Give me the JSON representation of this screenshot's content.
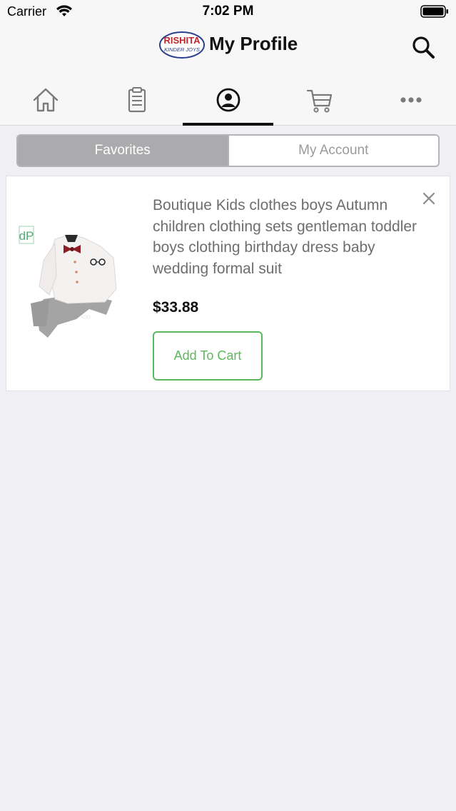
{
  "status_bar": {
    "carrier": "Carrier",
    "time": "7:02 PM",
    "wifi_icon": "wifi-icon",
    "battery_icon": "battery-icon"
  },
  "header": {
    "logo_text_top": "RISHITA",
    "logo_text_bottom": "KINDER JOYS",
    "title": "My Profile",
    "search_icon": "search-icon"
  },
  "tabs": [
    {
      "icon": "home-icon",
      "active": false
    },
    {
      "icon": "clipboard-icon",
      "active": false
    },
    {
      "icon": "profile-icon",
      "active": true
    },
    {
      "icon": "cart-icon",
      "active": false
    },
    {
      "icon": "more-icon",
      "active": false
    }
  ],
  "segmented": {
    "favorites_label": "Favorites",
    "account_label": "My Account",
    "selected": "Favorites"
  },
  "favorites": [
    {
      "name": "Boutique Kids clothes boys Autumn children clothing sets gentleman toddler boys clothing birthday dress baby wedding formal suit",
      "price": "$33.88",
      "add_to_cart_label": "Add To Cart",
      "remove_icon": "close-icon",
      "image_brand_mark": "dP"
    }
  ],
  "colors": {
    "accent_green": "#5cb85c",
    "segment_active": "#ababad",
    "background": "#efeff4"
  }
}
